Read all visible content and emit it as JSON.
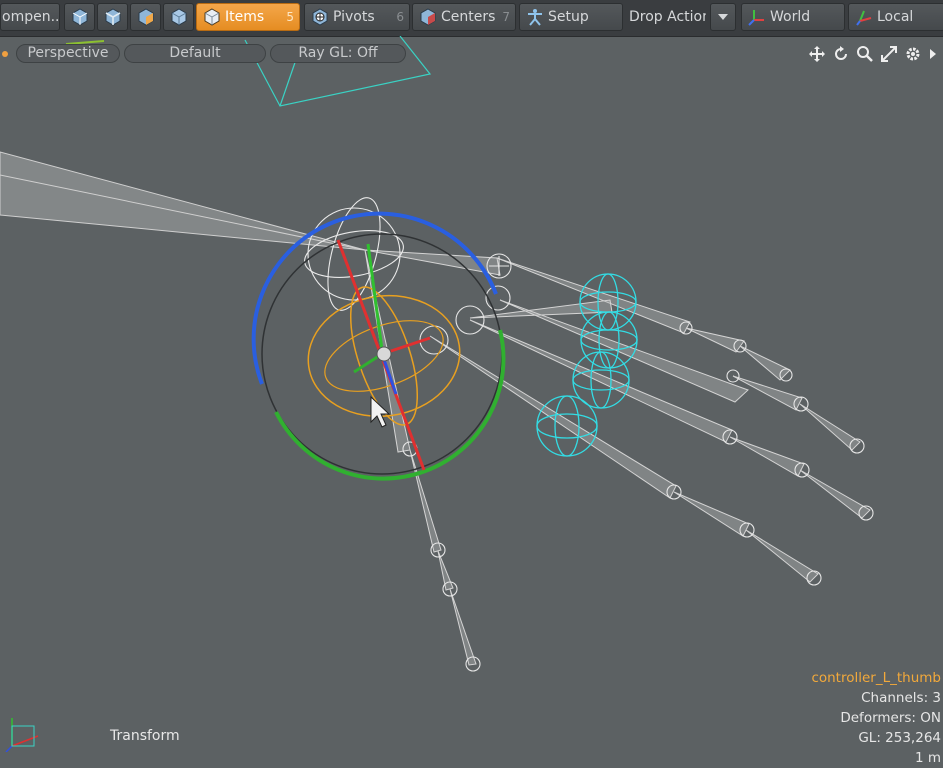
{
  "toolbar": {
    "component_label": "ompen...",
    "items_label": "Items",
    "items_num": "5",
    "pivots_label": "Pivots",
    "pivots_num": "6",
    "centers_label": "Centers",
    "centers_num": "7",
    "setup_label": "Setup",
    "drop_action_label": "Drop Action",
    "world_label": "World",
    "local_label": "Local"
  },
  "viewport": {
    "projection": "Perspective",
    "style": "Default",
    "raygl": "Ray GL: Off"
  },
  "info": {
    "selection": "controller_L_thumb",
    "channels": "Channels: 3",
    "deformers": "Deformers: ON",
    "gl": "GL: 253,264",
    "scale": "1 m"
  },
  "status": {
    "tool": "Transform"
  },
  "colors": {
    "accent": "#f0a040",
    "gizmo_red": "#e03030",
    "gizmo_green": "#30b030",
    "gizmo_blue": "#2a5fe0",
    "rotate_handle": "#e8a020",
    "controller": "#30d8e0",
    "bone": "#c8c8c8"
  }
}
